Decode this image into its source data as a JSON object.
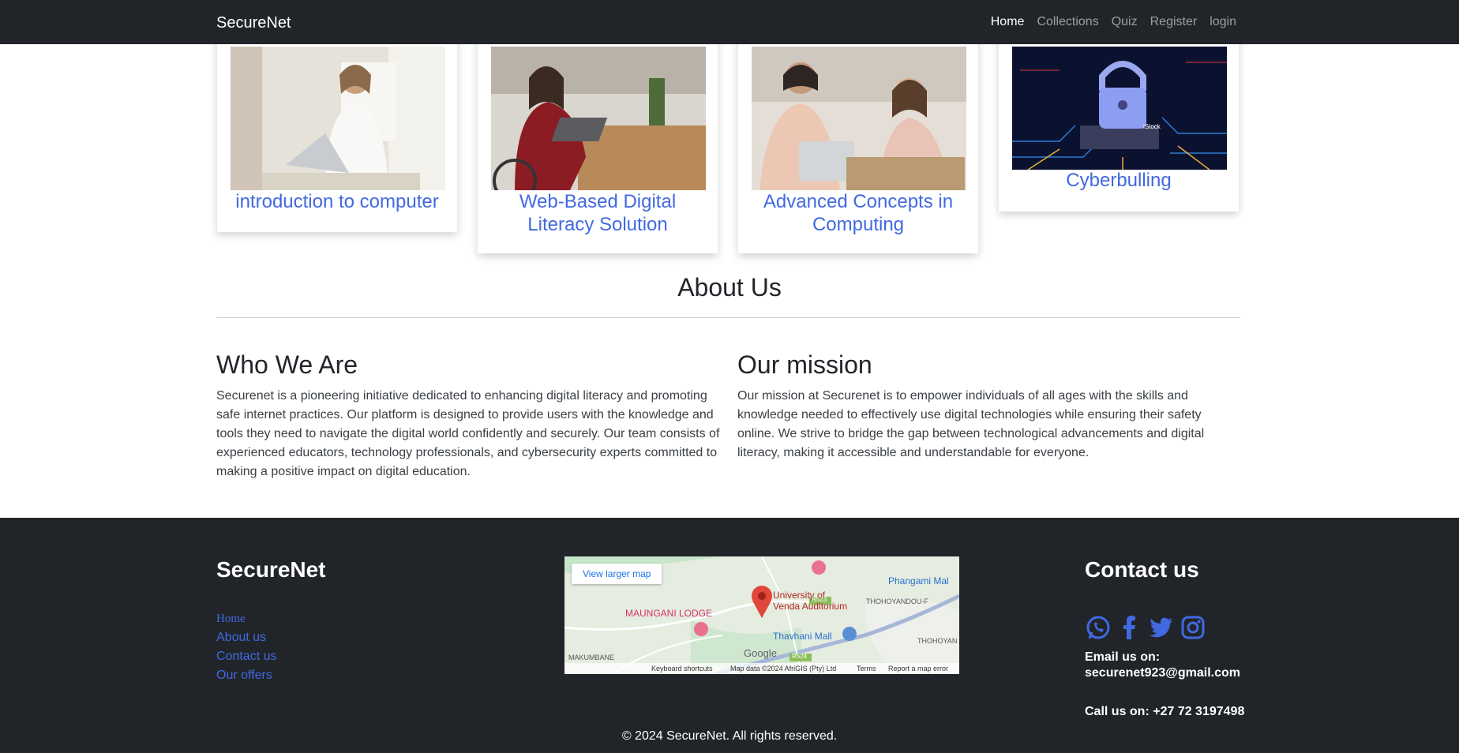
{
  "navbar": {
    "brand": "SecureNet",
    "links": [
      "Home",
      "Collections",
      "Quiz",
      "Register",
      "login"
    ]
  },
  "cards": [
    {
      "title": "introduction to computer"
    },
    {
      "title": "Web-Based Digital Literacy Solution"
    },
    {
      "title": "Advanced Concepts in Computing"
    },
    {
      "title": "Cyberbulling"
    }
  ],
  "about": {
    "title": "About Us",
    "who": {
      "heading": "Who We Are",
      "text": "Securenet is a pioneering initiative dedicated to enhancing digital literacy and promoting safe internet practices. Our platform is designed to provide users with the knowledge and tools they need to navigate the digital world confidently and securely. Our team consists of experienced educators, technology professionals, and cybersecurity experts committed to making a positive impact on digital education."
    },
    "mission": {
      "heading": "Our mission",
      "text": "Our mission at Securenet is to empower individuals of all ages with the skills and knowledge needed to effectively use digital technologies while ensuring their safety online. We strive to bridge the gap between technological advancements and digital literacy, making it accessible and understandable for everyone."
    }
  },
  "footer": {
    "brand": "SecureNet",
    "links": [
      "Home",
      "About us",
      "Contact us",
      "Our offers"
    ],
    "map": {
      "button": "View larger map",
      "labels": {
        "university": "University of",
        "university2": "Venda Auditorium",
        "lodge": "MAUNGANI LODGE",
        "mall": "Thavhani Mall",
        "phangami": "Phangami Mal",
        "thohoyandou_f": "THOHOYANDOU-F",
        "thohoyandou": "THOHOYAN",
        "makumbane": "MAKUMBANE",
        "r523": "R523",
        "r524": "R524",
        "google": "Google"
      },
      "footer": [
        "Keyboard shortcuts",
        "Map data ©2024 AfriGIS (Pty) Ltd",
        "Terms",
        "Report a map error"
      ]
    },
    "contact_heading": "Contact us",
    "socials": [
      "whatsapp-icon",
      "facebook-icon",
      "twitter-icon",
      "instagram-icon"
    ],
    "email_label": "Email us on:",
    "email": "securenet923@gmail.com",
    "phone": "Call us on: +27 72 3197498",
    "copyright": "© 2024 SecureNet. All rights reserved."
  },
  "colors": {
    "dark": "#212529",
    "link": "#4169e1"
  }
}
